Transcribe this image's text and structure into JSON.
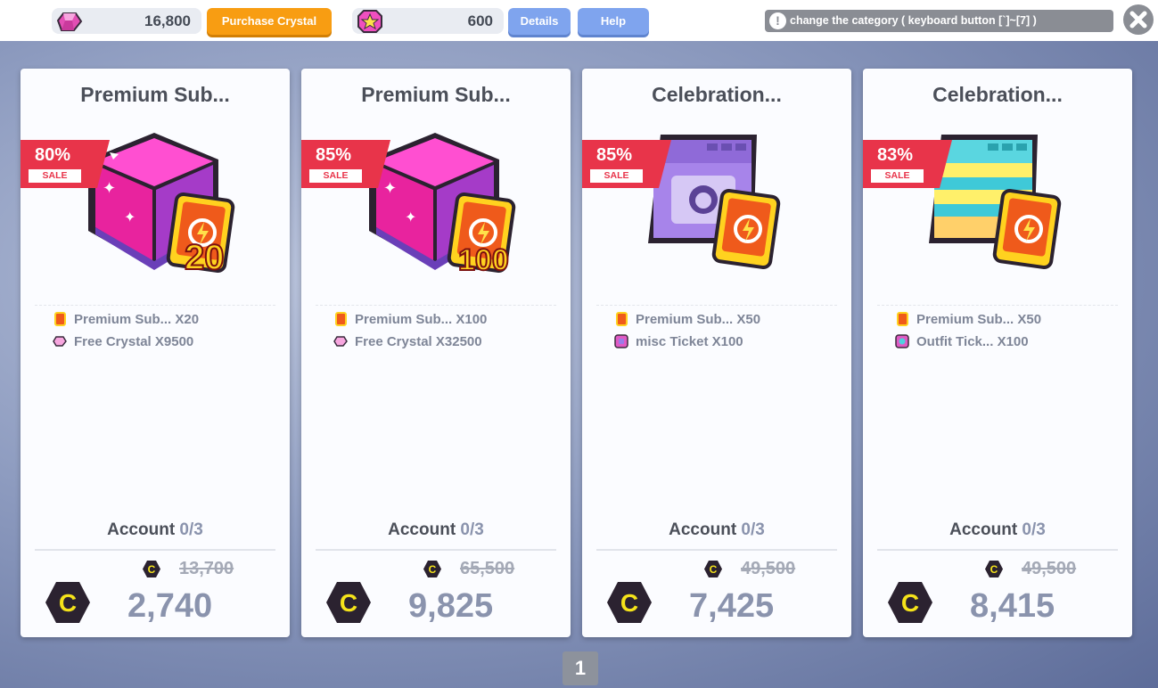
{
  "currencies": {
    "crystal_amount": "16,800",
    "purchase_label": "Purchase Crystal",
    "star_amount": "600",
    "details_label": "Details",
    "help_label": "Help"
  },
  "notice": {
    "text": "change the category ( keyboard button [`]~[7] )"
  },
  "cards": [
    {
      "title": "Premium Sub...",
      "sale_pct": "80%",
      "sale_label": "SALE",
      "badge": "20",
      "items": [
        "Premium Sub... X20",
        "Free Crystal X9500"
      ],
      "account_label": "Account",
      "account_count": "0/3",
      "old_price": "13,700",
      "price": "2,740"
    },
    {
      "title": "Premium Sub...",
      "sale_pct": "85%",
      "sale_label": "SALE",
      "badge": "100",
      "items": [
        "Premium Sub... X100",
        "Free Crystal X32500"
      ],
      "account_label": "Account",
      "account_count": "0/3",
      "old_price": "65,500",
      "price": "9,825"
    },
    {
      "title": "Celebration...",
      "sale_pct": "85%",
      "sale_label": "SALE",
      "items": [
        "Premium Sub... X50",
        "misc Ticket X100"
      ],
      "account_label": "Account",
      "account_count": "0/3",
      "old_price": "49,500",
      "price": "7,425"
    },
    {
      "title": "Celebration...",
      "sale_pct": "83%",
      "sale_label": "SALE",
      "items": [
        "Premium Sub... X50",
        "Outfit Tick... X100"
      ],
      "account_label": "Account",
      "account_count": "0/3",
      "old_price": "49,500",
      "price": "8,415"
    }
  ],
  "pagination": {
    "current_page": "1"
  },
  "colors": {
    "sale_red": "#e8344a",
    "purchase_orange": "#f89d12",
    "button_blue": "#7fa4ee",
    "coin_yellow": "#f5e31a",
    "price_gray": "#8a93ad"
  }
}
